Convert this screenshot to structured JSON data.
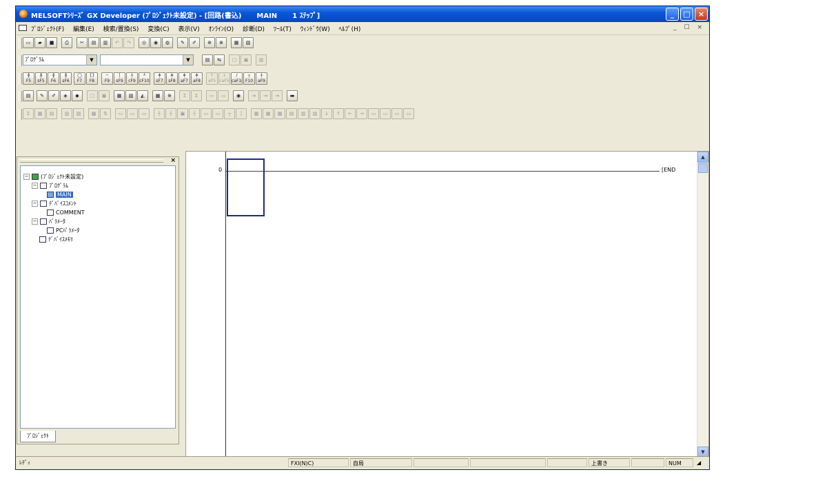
{
  "window": {
    "title_parts": [
      "MELSOFTｼﾘｰｽﾞ GX Developer (ﾌﾟﾛｼﾞｪｸﾄ未設定) - [回路(書込)",
      "MAIN",
      "1 ｽﾃｯﾌﾟ]"
    ],
    "controls": {
      "minimize": "_",
      "maximize": "□",
      "close": "×"
    }
  },
  "menu": {
    "items": [
      "ﾌﾟﾛｼﾞｪｸﾄ(F)",
      "編集(E)",
      "検索/置換(S)",
      "変換(C)",
      "表示(V)",
      "ｵﾝﾗｲﾝ(O)",
      "診断(D)",
      "ﾂｰﾙ(T)",
      "ｳｨﾝﾄﾞｳ(W)",
      "ﾍﾙﾌﾟ(H)"
    ],
    "mdi_controls": "_ ☐ ×"
  },
  "toolbar": {
    "program_type": "ﾌﾟﾛｸﾞﾗﾑ",
    "program_name": "",
    "row1": [
      "new-icon",
      "open-icon",
      "save-icon",
      "print-icon",
      "cut-icon",
      "copy-icon",
      "paste-icon",
      "undo-icon",
      "redo-icon",
      "find-device-icon",
      "find-instruction-icon",
      "find-step-icon",
      "write-plc-icon",
      "read-plc-icon",
      "monitor-icon",
      "monitor-stop-icon",
      "ladder-view-icon",
      "list-view-icon"
    ],
    "ladder_labels": [
      "F5",
      "sF5",
      "F6",
      "sF6",
      "F7",
      "F8",
      "F9",
      "sF9",
      "cF9",
      "cF10",
      "sF7",
      "sF8",
      "aF7",
      "aF8",
      "aF5",
      "caF5",
      "caF10",
      "F10",
      "aF9"
    ]
  },
  "project_panel": {
    "tree": [
      {
        "label": "(ﾌﾟﾛｼﾞｪｸﾄ未設定)",
        "level": 0,
        "expander": "−",
        "icon": "project-icon"
      },
      {
        "label": "ﾌﾟﾛｸﾞﾗﾑ",
        "level": 1,
        "expander": "−",
        "icon": "program-folder-icon"
      },
      {
        "label": "MAIN",
        "level": 2,
        "expander": "",
        "icon": "ladder-program-icon",
        "selected": true
      },
      {
        "label": "ﾃﾞﾊﾞｲｽｺﾒﾝﾄ",
        "level": 1,
        "expander": "−",
        "icon": "device-comment-icon"
      },
      {
        "label": "COMMENT",
        "level": 2,
        "expander": "",
        "icon": "comment-file-icon"
      },
      {
        "label": "ﾊﾟﾗﾒｰﾀ",
        "level": 1,
        "expander": "−",
        "icon": "parameter-folder-icon"
      },
      {
        "label": "PCﾊﾟﾗﾒｰﾀ",
        "level": 2,
        "expander": "",
        "icon": "pc-parameter-icon"
      },
      {
        "label": "ﾃﾞﾊﾞｲｽﾒﾓﾘ",
        "level": 1,
        "expander": "",
        "icon": "device-memory-icon"
      }
    ],
    "tab_label": "ﾌﾟﾛｼﾞｪｸﾄ",
    "close_label": "×"
  },
  "ladder": {
    "step": "0",
    "end_instruction": "[END",
    "end_bracket": "]"
  },
  "status": {
    "ready": "ﾚﾃﾞｨ",
    "cpu": "FXI(N)C)",
    "station": "自局",
    "mode": "上書き",
    "num": "NUM"
  },
  "colors": {
    "titlebar": "#0b57d8",
    "background": "#ece9d8",
    "selection": "#316ac5",
    "cursor": "#1a2a8a"
  }
}
